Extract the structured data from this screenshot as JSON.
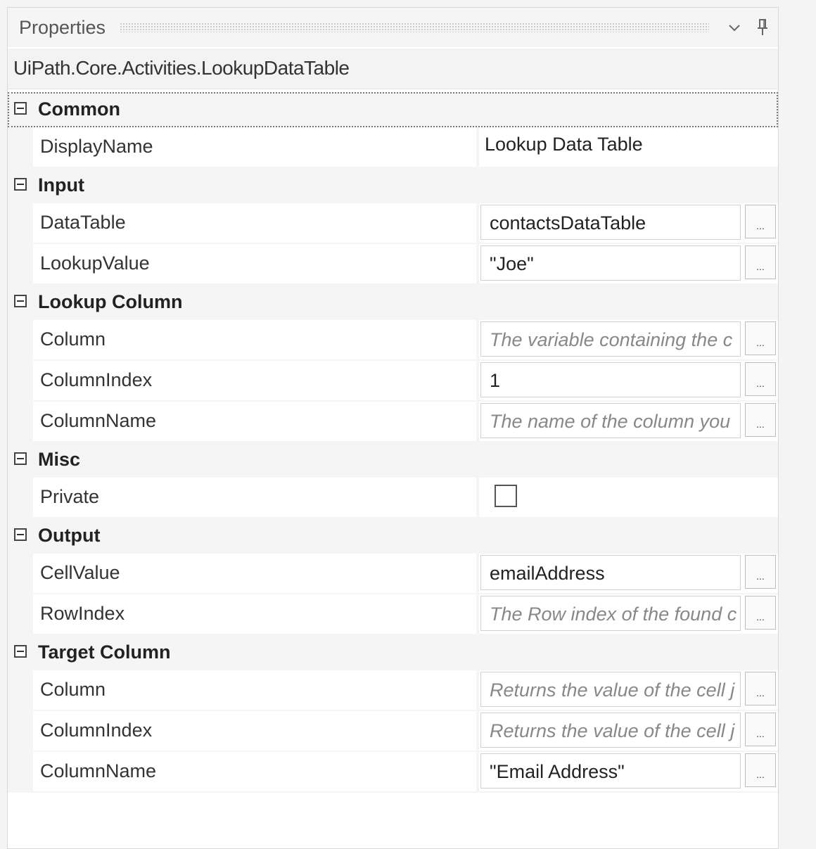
{
  "panel": {
    "title": "Properties",
    "dropdown_icon": "chevron-down-icon",
    "pin_icon": "pin-icon"
  },
  "activity_type": "UiPath.Core.Activities.LookupDataTable",
  "categories": [
    {
      "name": "Common",
      "rows": [
        {
          "label": "DisplayName",
          "kind": "plain",
          "value": "Lookup Data Table"
        }
      ]
    },
    {
      "name": "Input",
      "rows": [
        {
          "label": "DataTable",
          "kind": "input",
          "value": "contactsDataTable",
          "placeholder": ""
        },
        {
          "label": "LookupValue",
          "kind": "input",
          "value": "\"Joe\"",
          "placeholder": ""
        }
      ]
    },
    {
      "name": "Lookup Column",
      "rows": [
        {
          "label": "Column",
          "kind": "input",
          "value": "",
          "placeholder": "The variable containing the c"
        },
        {
          "label": "ColumnIndex",
          "kind": "input",
          "value": "1",
          "placeholder": ""
        },
        {
          "label": "ColumnName",
          "kind": "input",
          "value": "",
          "placeholder": "The name of the column you"
        }
      ]
    },
    {
      "name": "Misc",
      "rows": [
        {
          "label": "Private",
          "kind": "checkbox",
          "checked": false
        }
      ]
    },
    {
      "name": "Output",
      "rows": [
        {
          "label": "CellValue",
          "kind": "input",
          "value": "emailAddress",
          "placeholder": ""
        },
        {
          "label": "RowIndex",
          "kind": "input",
          "value": "",
          "placeholder": "The Row index of the found c"
        }
      ]
    },
    {
      "name": "Target Column",
      "rows": [
        {
          "label": "Column",
          "kind": "input",
          "value": "",
          "placeholder": "Returns the value of the cell j"
        },
        {
          "label": "ColumnIndex",
          "kind": "input",
          "value": "",
          "placeholder": "Returns the value of the cell j"
        },
        {
          "label": "ColumnName",
          "kind": "input",
          "value": "\"Email Address\"",
          "placeholder": ""
        }
      ]
    }
  ],
  "ellipsis_label": "...",
  "colors": {
    "category_bg": "#f5f5f5",
    "row_bg": "#ffffff",
    "border": "#d0d0d0",
    "placeholder": "#888888"
  }
}
